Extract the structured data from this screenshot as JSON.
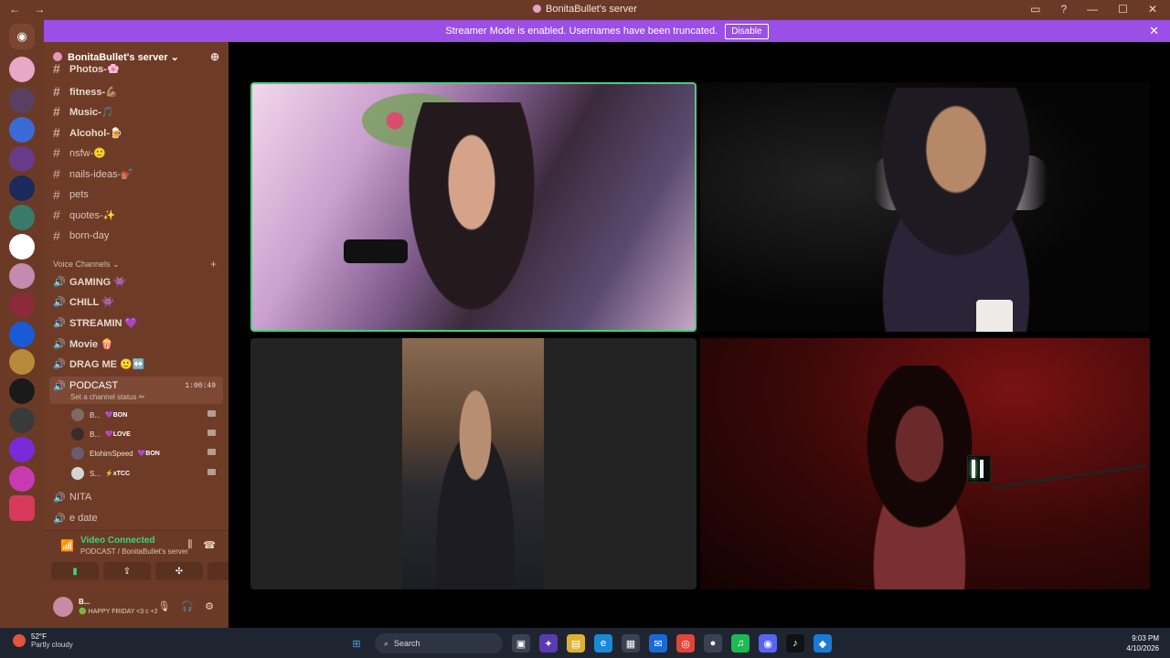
{
  "titlebar": {
    "title": "BonitaBullet's server",
    "nav": "←  →"
  },
  "banner": {
    "text": "Streamer Mode is enabled. Usernames have been truncated.",
    "button": "Disable"
  },
  "server": {
    "name": "BonitaBullet's server ⌄"
  },
  "text_channels": [
    "Photos-🌸",
    "fitness-💪🏽",
    "Music-🎵",
    "Alcohol-🍺",
    "nsfw-🙂",
    "nails-ideas-💅🏽",
    "pets",
    "quotes-✨",
    "born-day"
  ],
  "voice_category": "Voice Channels ⌄",
  "voice_channels": [
    "GAMING 👾",
    "CHILL 👾",
    "STREAMIN 💜",
    "Movie 🍿",
    "DRAG ME 🙂↔️"
  ],
  "active_channel": {
    "name": "PODCAST",
    "timer": "1:00:49",
    "status": "Set a channel status ✏"
  },
  "members": [
    {
      "name": "B...",
      "badge": "💜BON",
      "color": "#7c6a66"
    },
    {
      "name": "B...",
      "badge": "💜LOVE",
      "color": "#3b2c2b"
    },
    {
      "name": "ElohimSpeed",
      "badge": "💜BON",
      "color": "#6b5b6e"
    },
    {
      "name": "S...",
      "badge": "⚡xTCC",
      "color": "#d4d4d4"
    }
  ],
  "more_channels": [
    "NITA",
    "e date"
  ],
  "voice_panel": {
    "title": "Video Connected",
    "subtitle": "PODCAST / BonitaBullet's server"
  },
  "user_panel": {
    "name": "B...",
    "status": "🟢 HAPPY FRIDAY <3 c +2"
  },
  "taskbar": {
    "temp": "52°F",
    "condition": "Partly cloudy",
    "search": "Search",
    "time": "9:03 PM",
    "date": "4/10/2026"
  },
  "colors": {
    "accent": "#43d17b",
    "banner": "#9b4fe6",
    "sidebar": "#6e3b27"
  }
}
